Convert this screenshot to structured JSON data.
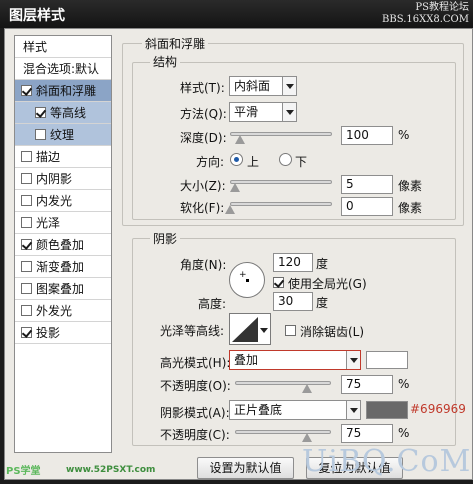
{
  "window": {
    "title": "图层样式",
    "watermark_line1": "PS教程论坛",
    "watermark_line2": "BBS.16XX8.COM"
  },
  "left_list": {
    "header": "样式",
    "blend_options": "混合选项:默认",
    "items": [
      {
        "label": "斜面和浮雕",
        "checked": true,
        "selected": true
      },
      {
        "label": "等高线",
        "checked": true,
        "sub": true
      },
      {
        "label": "纹理",
        "checked": false,
        "sub": true
      },
      {
        "label": "描边",
        "checked": false
      },
      {
        "label": "内阴影",
        "checked": false
      },
      {
        "label": "内发光",
        "checked": false
      },
      {
        "label": "光泽",
        "checked": false
      },
      {
        "label": "颜色叠加",
        "checked": true
      },
      {
        "label": "渐变叠加",
        "checked": false
      },
      {
        "label": "图案叠加",
        "checked": false
      },
      {
        "label": "外发光",
        "checked": false
      },
      {
        "label": "投影",
        "checked": true
      }
    ]
  },
  "bevel": {
    "group_title": "斜面和浮雕",
    "structure_title": "结构",
    "style_label": "样式(T):",
    "style_value": "内斜面",
    "technique_label": "方法(Q):",
    "technique_value": "平滑",
    "depth_label": "深度(D):",
    "depth_value": "100",
    "depth_unit": "%",
    "depth_level": 0.1,
    "direction_label": "方向:",
    "dir_up": "上",
    "dir_down": "下",
    "size_label": "大小(Z):",
    "size_value": "5",
    "size_unit": "像素",
    "size_level": 0.05,
    "soften_label": "软化(F):",
    "soften_value": "0",
    "soften_unit": "像素",
    "soften_level": 0
  },
  "shading": {
    "group_title": "阴影",
    "angle_label": "角度(N):",
    "angle_value": "120",
    "angle_unit": "度",
    "global_light_label": "使用全局光(G)",
    "global_light_checked": true,
    "altitude_label": "高度:",
    "altitude_value": "30",
    "altitude_unit": "度",
    "gloss_contour_label": "光泽等高线:",
    "antialias_label": "消除锯齿(L)",
    "antialias_checked": false,
    "highlight_mode_label": "高光模式(H):",
    "highlight_mode_value": "叠加",
    "highlight_color": "#ffffff",
    "highlight_opacity_label": "不透明度(O):",
    "highlight_opacity_value": "75",
    "highlight_opacity_level": 0.75,
    "shadow_mode_label": "阴影模式(A):",
    "shadow_mode_value": "正片叠底",
    "shadow_color": "#696969",
    "shadow_color_note": "#696969",
    "shadow_opacity_label": "不透明度(C):",
    "shadow_opacity_value": "75",
    "shadow_opacity_level": 0.75,
    "percent": "%"
  },
  "buttons": {
    "set_default": "设置为默认值",
    "reset_default": "复位为默认值"
  },
  "overlay": {
    "brand": "UiBQ.CoM",
    "bottom_left": "PS学堂",
    "bottom_mid": "www.52PSXT.com"
  }
}
